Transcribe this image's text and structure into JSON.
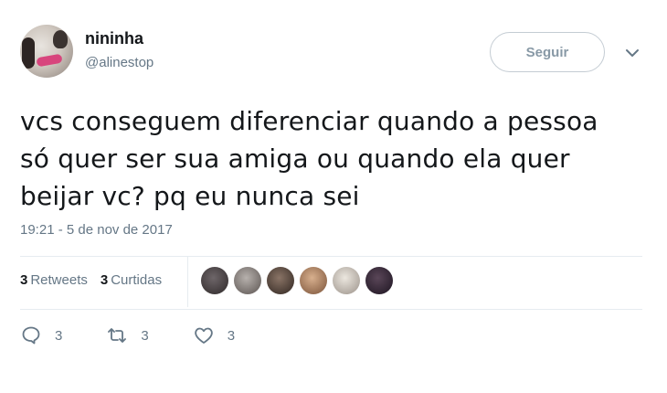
{
  "user": {
    "name": "nininha",
    "handle": "@alinestop"
  },
  "follow_button": {
    "label": "Seguir"
  },
  "tweet": {
    "lines": [
      "vcs conseguem diferenciar quando a pessoa",
      "só quer ser sua amiga ou quando ela quer",
      "beijar vc? pq eu nunca sei"
    ],
    "timestamp": "19:21 - 5 de nov de 2017"
  },
  "stats": {
    "retweets_count": "3",
    "retweets_label": "Retweets",
    "likes_count": "3",
    "likes_label": "Curtidas"
  },
  "likers": [
    {
      "color": "#4a4345"
    },
    {
      "color": "#8c8582"
    },
    {
      "color": "#5b4a3f"
    },
    {
      "color": "#b58a6a"
    },
    {
      "color": "#cfc9c0"
    },
    {
      "color": "#2c2230"
    }
  ],
  "actions": {
    "reply_count": "3",
    "retweet_count": "3",
    "like_count": "3"
  },
  "icons": [
    "reply-icon",
    "retweet-icon",
    "heart-icon",
    "chevron-down-icon"
  ]
}
